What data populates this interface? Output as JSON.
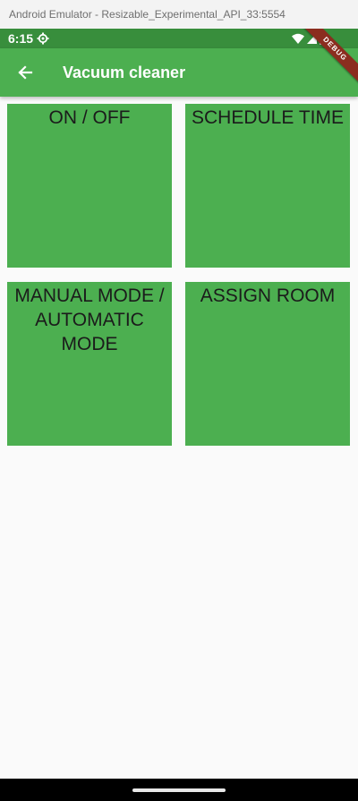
{
  "window": {
    "title": "Android Emulator - Resizable_Experimental_API_33:5554"
  },
  "status_bar": {
    "time": "6:15",
    "icons": [
      "settings-icon",
      "wifi-icon",
      "cellular-signal-icon",
      "battery-icon"
    ]
  },
  "app_bar": {
    "title": "Vacuum cleaner",
    "back_icon": "arrow-back-icon",
    "debug_banner": "DEBUG"
  },
  "tiles": [
    {
      "label": "ON / OFF"
    },
    {
      "label": "SCHEDULE TIME"
    },
    {
      "label": "MANUAL MODE /\nAUTOMATIC\nMODE"
    },
    {
      "label": "ASSIGN ROOM"
    }
  ],
  "colors": {
    "status_bar": "#388e3c",
    "app_bar": "#4caf50",
    "tile": "#4caf50",
    "background": "#fafafa",
    "debug_banner": "#8b2d1f"
  }
}
